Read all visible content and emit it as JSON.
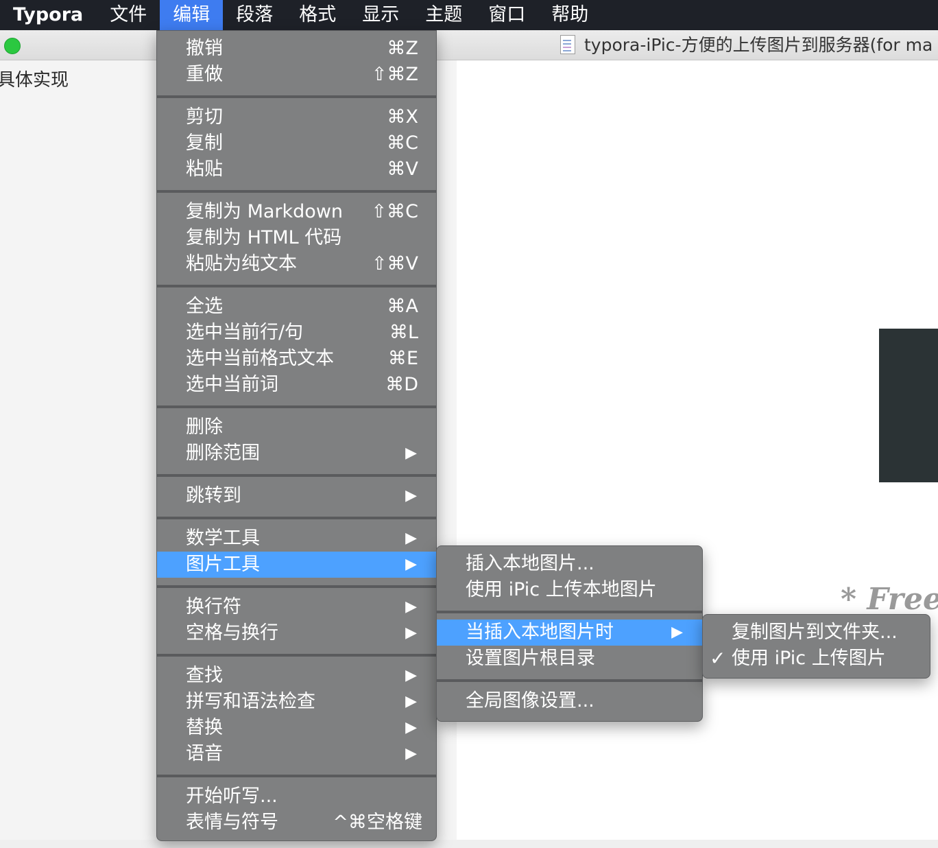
{
  "menubar": {
    "app_name": "Typora",
    "items": [
      "文件",
      "编辑",
      "段落",
      "格式",
      "显示",
      "主题",
      "窗口",
      "帮助"
    ],
    "active_index": 1
  },
  "window": {
    "title": "typora-iPic-方便的上传图片到服务器(for ma"
  },
  "sidebar": {
    "text": "具体实现"
  },
  "editor": {
    "visible_text": "* Free"
  },
  "edit_menu": {
    "undo": {
      "label": "撤销",
      "shortcut": "⌘Z"
    },
    "redo": {
      "label": "重做",
      "shortcut": "⇧⌘Z"
    },
    "cut": {
      "label": "剪切",
      "shortcut": "⌘X"
    },
    "copy": {
      "label": "复制",
      "shortcut": "⌘C"
    },
    "paste": {
      "label": "粘贴",
      "shortcut": "⌘V"
    },
    "copy_markdown": {
      "label": "复制为 Markdown",
      "shortcut": "⇧⌘C"
    },
    "copy_html": {
      "label": "复制为 HTML 代码",
      "shortcut": ""
    },
    "paste_plain": {
      "label": "粘贴为纯文本",
      "shortcut": "⇧⌘V"
    },
    "select_all": {
      "label": "全选",
      "shortcut": "⌘A"
    },
    "select_line": {
      "label": "选中当前行/句",
      "shortcut": "⌘L"
    },
    "select_format": {
      "label": "选中当前格式文本",
      "shortcut": "⌘E"
    },
    "select_word": {
      "label": "选中当前词",
      "shortcut": "⌘D"
    },
    "delete": {
      "label": "删除"
    },
    "delete_range": {
      "label": "删除范围"
    },
    "jump_to": {
      "label": "跳转到"
    },
    "math_tools": {
      "label": "数学工具"
    },
    "image_tools": {
      "label": "图片工具"
    },
    "line_break": {
      "label": "换行符"
    },
    "whitespace": {
      "label": "空格与换行"
    },
    "find": {
      "label": "查找"
    },
    "spelling": {
      "label": "拼写和语法检查"
    },
    "replace": {
      "label": "替换"
    },
    "speech": {
      "label": "语音"
    },
    "dictation": {
      "label": "开始听写..."
    },
    "emoji": {
      "label": "表情与符号",
      "shortcut": "^⌘空格键"
    },
    "arrow": "▶"
  },
  "image_tools_menu": {
    "insert_local": "插入本地图片...",
    "upload_ipic": "使用 iPic 上传本地图片",
    "when_insert": "当插入本地图片时",
    "set_root": "设置图片根目录",
    "global_settings": "全局图像设置..."
  },
  "when_insert_menu": {
    "copy_to_folder": "复制图片到文件夹...",
    "use_ipic": "使用 iPic 上传图片",
    "checkmark": "✓"
  }
}
